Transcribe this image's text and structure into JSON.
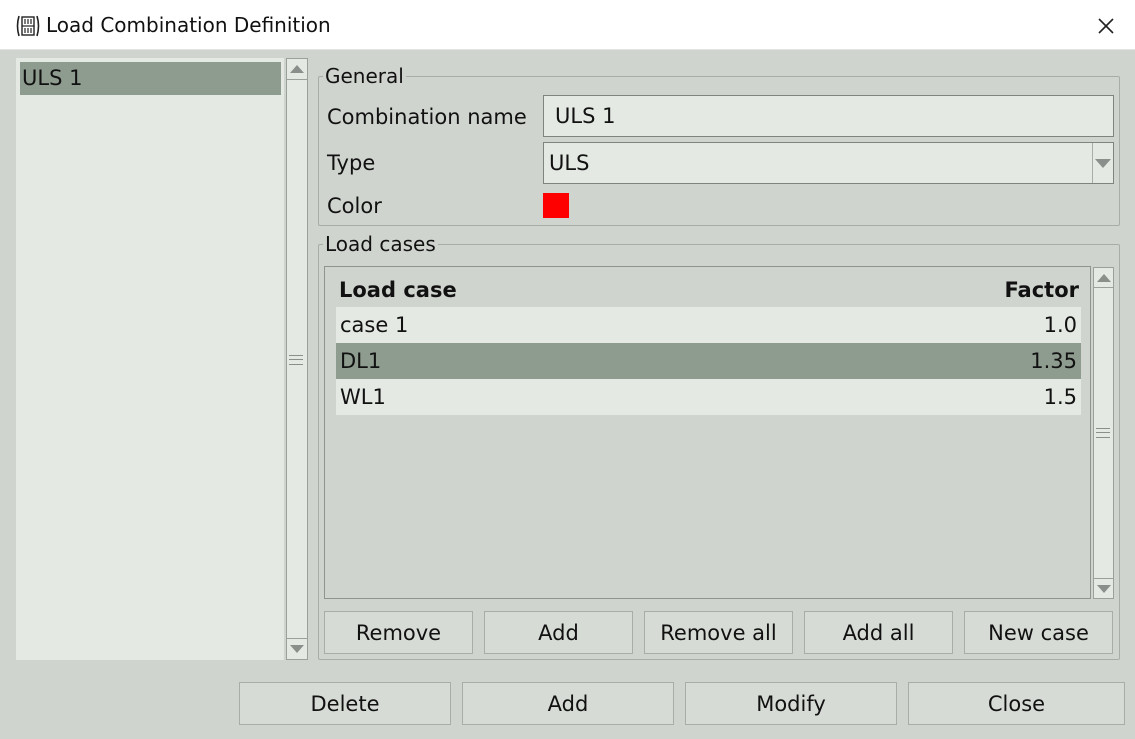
{
  "window": {
    "title": "Load Combination Definition"
  },
  "combination_list": {
    "items": [
      "ULS 1"
    ]
  },
  "general": {
    "legend": "General",
    "name_label": "Combination name",
    "name_value": "ULS 1",
    "type_label": "Type",
    "type_value": "ULS",
    "color_label": "Color",
    "color_value": "#ff0000"
  },
  "load_cases": {
    "legend": "Load cases",
    "headers": {
      "case": "Load case",
      "factor": "Factor"
    },
    "rows": [
      {
        "case": "case 1",
        "factor": "1.0"
      },
      {
        "case": "DL1",
        "factor": "1.35"
      },
      {
        "case": "WL1",
        "factor": "1.5"
      }
    ],
    "selected_row": "DL1",
    "buttons": {
      "remove": "Remove",
      "add": "Add",
      "remove_all": "Remove all",
      "add_all": "Add all",
      "new_case": "New case"
    }
  },
  "footer": {
    "delete": "Delete",
    "add": "Add",
    "modify": "Modify",
    "close": "Close"
  },
  "colors": {
    "selection": "#8e9b8f",
    "panel": "#d0d4cf",
    "field": "#e4e9e3"
  }
}
